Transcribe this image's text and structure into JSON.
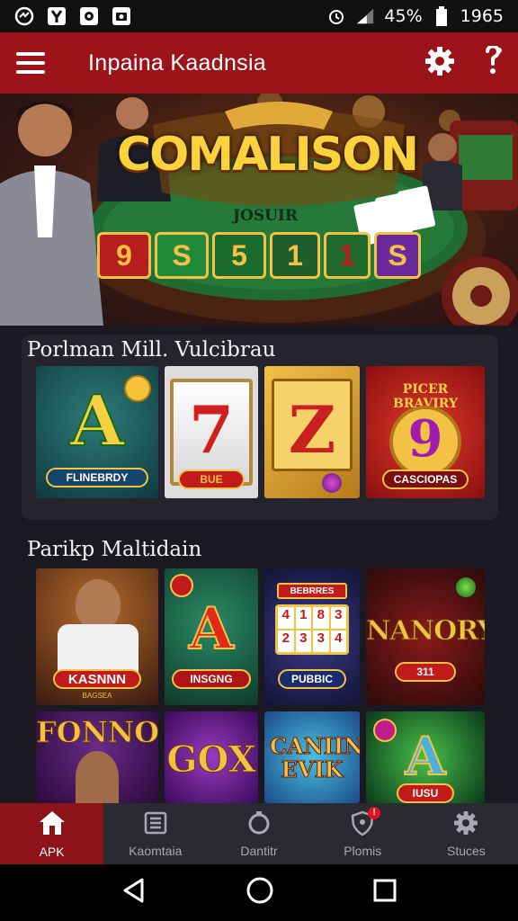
{
  "status_bar": {
    "icons": [
      "chat-icon",
      "y-app-icon",
      "circle-app-icon",
      "camera-icon"
    ],
    "signal_icon": "signal-icon",
    "battery_percent": "45%",
    "time": "1965"
  },
  "app_bar": {
    "title": "Inpaina Kaadnsia",
    "menu_icon": "hamburger-menu-icon",
    "settings_icon": "gear-icon",
    "alert_icon": "alert-icon"
  },
  "hero": {
    "logo_text": "COMALISON",
    "sub_text": "JOSUIR",
    "reel_symbols": [
      "9",
      "S",
      "5",
      "1",
      "1",
      "S"
    ]
  },
  "section1": {
    "title": "Porlman Mill. Vulcibrau",
    "tiles": [
      {
        "big": "A",
        "badge": "FLINEBRDY"
      },
      {
        "big": "7",
        "badge": "BUE"
      },
      {
        "big": "Z",
        "badge": ""
      },
      {
        "big": "9",
        "top": "PICER BRAVIRY",
        "badge": "CASCIOPAS"
      }
    ]
  },
  "section2": {
    "title": "Parikp Maltidain",
    "tiles": [
      {
        "badge": "KASNNN",
        "sub": "BAGSEA"
      },
      {
        "big": "A",
        "badge": "INSGNG"
      },
      {
        "top": "BEBRRES",
        "grid": [
          "4",
          "1",
          "8",
          "3",
          "2",
          "3",
          "3",
          "4"
        ],
        "badge": "PUBBIC"
      },
      {
        "big": "NANORY",
        "badge": "311"
      },
      {
        "big": "FONNO"
      },
      {
        "big": "GOX"
      },
      {
        "big": "CANIIN EVIK"
      },
      {
        "big": "A",
        "badge": "IUSU"
      }
    ]
  },
  "bottom_nav": [
    {
      "label": "APK",
      "icon": "home-icon",
      "active": true
    },
    {
      "label": "Kaomtaia",
      "icon": "list-icon",
      "active": false
    },
    {
      "label": "Dantitr",
      "icon": "timer-icon",
      "active": false
    },
    {
      "label": "Plomis",
      "icon": "shield-icon",
      "active": false,
      "badge": "!"
    },
    {
      "label": "Stuces",
      "icon": "gear-icon",
      "active": false
    }
  ],
  "system_nav": [
    "back-icon",
    "home-circle-icon",
    "recents-icon"
  ],
  "colors": {
    "app_bar": "#9c1419",
    "background": "#1a1922",
    "section_bg": "#24232e",
    "nav_active": "#8e1318",
    "gold": "#f3c244"
  }
}
